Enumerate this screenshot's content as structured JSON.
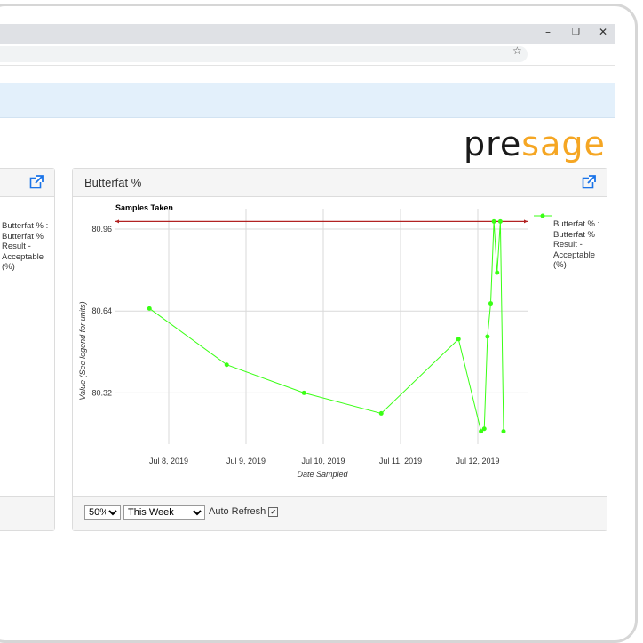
{
  "browser": {
    "window_controls": [
      "–",
      "❐",
      "✕"
    ],
    "bookmark_icon": "star-icon"
  },
  "logo": {
    "pre": "pre",
    "sage": "sage"
  },
  "left_panel": {
    "legend_text": "Butterfat % :\nButterfat %\nResult -\nAcceptable\n(%)"
  },
  "panel": {
    "title": "Butterfat %",
    "open_icon": "external-link-icon",
    "zoom_value": "50%",
    "range_value": "This Week",
    "auto_refresh_label": "Auto Refresh",
    "auto_refresh_checked": "✔"
  },
  "chart_data": {
    "type": "line",
    "title": "Samples Taken",
    "xlabel": "Date Sampled",
    "ylabel": "Value (See legend for units)",
    "x_ticks": [
      "Jul 8, 2019",
      "Jul 9, 2019",
      "Jul 10, 2019",
      "Jul 11, 2019",
      "Jul 12, 2019"
    ],
    "y_ticks": [
      "80.32",
      "80.64",
      "80.96"
    ],
    "ylim": [
      80.12,
      81.04
    ],
    "grid": true,
    "legend_position": "right",
    "series_color": "#39ff14",
    "limit_line": {
      "value": 80.99,
      "color": "#b22222"
    },
    "series": [
      {
        "name": "Butterfat % : Butterfat % Result - Acceptable (%)",
        "points": [
          [
            "2019-07-07 18:00",
            80.65
          ],
          [
            "2019-07-08 18:00",
            80.43
          ],
          [
            "2019-07-09 18:00",
            80.32
          ],
          [
            "2019-07-10 18:00",
            80.24
          ],
          [
            "2019-07-11 18:00",
            80.53
          ],
          [
            "2019-07-12 01:00",
            80.17
          ],
          [
            "2019-07-12 02:00",
            80.18
          ],
          [
            "2019-07-12 03:00",
            80.54
          ],
          [
            "2019-07-12 04:00",
            80.67
          ],
          [
            "2019-07-12 05:00",
            80.99
          ],
          [
            "2019-07-12 06:00",
            80.79
          ],
          [
            "2019-07-12 07:00",
            80.99
          ],
          [
            "2019-07-12 08:00",
            80.17
          ]
        ]
      }
    ]
  }
}
